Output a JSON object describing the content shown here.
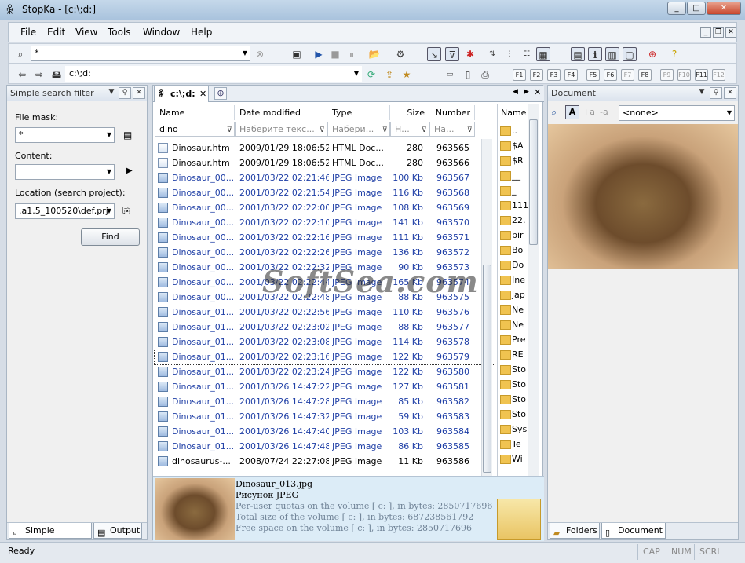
{
  "window": {
    "title": "StopKa - [c:\\;d:]",
    "minimize": "_",
    "maximize": "□",
    "close": "✕"
  },
  "menu": [
    "File",
    "Edit",
    "View",
    "Tools",
    "Window",
    "Help"
  ],
  "toolbar": {
    "search_value": "*",
    "path_value": "c:\\;d:",
    "fkeys": [
      "F1",
      "F2",
      "F3",
      "F4",
      "F5",
      "F6",
      "F7",
      "F8",
      "F9",
      "F10",
      "F11",
      "F12"
    ]
  },
  "left_panel": {
    "title": "Simple search filter",
    "file_mask_label": "File mask:",
    "file_mask_value": "*",
    "content_label": "Content:",
    "content_value": "",
    "location_label": "Location (search project):",
    "location_value": ".a1.5_100520\\def.prj",
    "find_button": "Find",
    "tabs": [
      "Simple search...",
      "Output"
    ]
  },
  "center": {
    "tab_label": "c:\\;d:",
    "columns": [
      "Name",
      "Date modified",
      "Type",
      "Size",
      "Number"
    ],
    "filters": [
      "dino",
      "Наберите текс...",
      "Набери...",
      "Н...",
      "На..."
    ],
    "rows": [
      {
        "name": "Dinosaur.htm",
        "date": "2009/01/29 18:06:52",
        "type": "HTML Doc...",
        "size": "280",
        "number": "963565",
        "kind": "htm",
        "blue": false
      },
      {
        "name": "Dinosaur.htm",
        "date": "2009/01/29 18:06:52",
        "type": "HTML Doc...",
        "size": "280",
        "number": "963566",
        "kind": "htm",
        "blue": false
      },
      {
        "name": "Dinosaur_00...",
        "date": "2001/03/22 02:21:46",
        "type": "JPEG Image",
        "size": "100 Kb",
        "number": "963567",
        "kind": "jpg",
        "blue": true
      },
      {
        "name": "Dinosaur_00...",
        "date": "2001/03/22 02:21:54",
        "type": "JPEG Image",
        "size": "116 Kb",
        "number": "963568",
        "kind": "jpg",
        "blue": true
      },
      {
        "name": "Dinosaur_00...",
        "date": "2001/03/22 02:22:00",
        "type": "JPEG Image",
        "size": "108 Kb",
        "number": "963569",
        "kind": "jpg",
        "blue": true
      },
      {
        "name": "Dinosaur_00...",
        "date": "2001/03/22 02:22:10",
        "type": "JPEG Image",
        "size": "141 Kb",
        "number": "963570",
        "kind": "jpg",
        "blue": true
      },
      {
        "name": "Dinosaur_00...",
        "date": "2001/03/22 02:22:16",
        "type": "JPEG Image",
        "size": "111 Kb",
        "number": "963571",
        "kind": "jpg",
        "blue": true
      },
      {
        "name": "Dinosaur_00...",
        "date": "2001/03/22 02:22:26",
        "type": "JPEG Image",
        "size": "136 Kb",
        "number": "963572",
        "kind": "jpg",
        "blue": true
      },
      {
        "name": "Dinosaur_00...",
        "date": "2001/03/22 02:22:32",
        "type": "JPEG Image",
        "size": "90 Kb",
        "number": "963573",
        "kind": "jpg",
        "blue": true
      },
      {
        "name": "Dinosaur_00...",
        "date": "2001/03/22 02:22:44",
        "type": "JPEG Image",
        "size": "165 Kb",
        "number": "963574",
        "kind": "jpg",
        "blue": true
      },
      {
        "name": "Dinosaur_00...",
        "date": "2001/03/22 02:22:48",
        "type": "JPEG Image",
        "size": "88 Kb",
        "number": "963575",
        "kind": "jpg",
        "blue": true
      },
      {
        "name": "Dinosaur_01...",
        "date": "2001/03/22 02:22:56",
        "type": "JPEG Image",
        "size": "110 Kb",
        "number": "963576",
        "kind": "jpg",
        "blue": true
      },
      {
        "name": "Dinosaur_01...",
        "date": "2001/03/22 02:23:02",
        "type": "JPEG Image",
        "size": "88 Kb",
        "number": "963577",
        "kind": "jpg",
        "blue": true
      },
      {
        "name": "Dinosaur_01...",
        "date": "2001/03/22 02:23:08",
        "type": "JPEG Image",
        "size": "114 Kb",
        "number": "963578",
        "kind": "jpg",
        "blue": true
      },
      {
        "name": "Dinosaur_01...",
        "date": "2001/03/22 02:23:16",
        "type": "JPEG Image",
        "size": "122 Kb",
        "number": "963579",
        "kind": "jpg",
        "blue": true,
        "selected": true
      },
      {
        "name": "Dinosaur_01...",
        "date": "2001/03/22 02:23:24",
        "type": "JPEG Image",
        "size": "122 Kb",
        "number": "963580",
        "kind": "jpg",
        "blue": true
      },
      {
        "name": "Dinosaur_01...",
        "date": "2001/03/26 14:47:22",
        "type": "JPEG Image",
        "size": "127 Kb",
        "number": "963581",
        "kind": "jpg",
        "blue": true
      },
      {
        "name": "Dinosaur_01...",
        "date": "2001/03/26 14:47:28",
        "type": "JPEG Image",
        "size": "85 Kb",
        "number": "963582",
        "kind": "jpg",
        "blue": true
      },
      {
        "name": "Dinosaur_01...",
        "date": "2001/03/26 14:47:32",
        "type": "JPEG Image",
        "size": "59 Kb",
        "number": "963583",
        "kind": "jpg",
        "blue": true
      },
      {
        "name": "Dinosaur_01...",
        "date": "2001/03/26 14:47:40",
        "type": "JPEG Image",
        "size": "103 Kb",
        "number": "963584",
        "kind": "jpg",
        "blue": true
      },
      {
        "name": "Dinosaur_01...",
        "date": "2001/03/26 14:47:48",
        "type": "JPEG Image",
        "size": "86 Kb",
        "number": "963585",
        "kind": "jpg",
        "blue": true
      },
      {
        "name": "dinosaurus-...",
        "date": "2008/07/24 22:27:08",
        "type": "JPEG Image",
        "size": "11 Kb",
        "number": "963586",
        "kind": "jpg",
        "blue": false
      }
    ],
    "folders_header": "Name",
    "folders": [
      "..",
      "$A",
      "$R",
      "__",
      "_",
      "111",
      "22.",
      "bir",
      "Bo",
      "Do",
      "Ine",
      "jap",
      "Ne",
      "Ne",
      "Pre",
      "RE",
      "Sto",
      "Sto",
      "Sto",
      "Sto",
      "Sys",
      "Te",
      "Wi"
    ],
    "preview": {
      "filename": "Dinosaur_013.jpg",
      "kind": "Рисунок JPEG",
      "line1": "Per-user quotas on the volume [ c: ], in bytes: 2850717696",
      "line2": "Total size of the volume [ c: ], in bytes: 687238561792",
      "line3": "Free space on the volume [ c: ], in bytes: 2850717696"
    }
  },
  "right_panel": {
    "title": "Document",
    "combo_value": "<none>",
    "tabs": [
      "Folders",
      "Document"
    ]
  },
  "status": {
    "text": "Ready",
    "cap": "CAP",
    "num": "NUM",
    "scrl": "SCRL"
  },
  "watermark": "SoftSea.com"
}
